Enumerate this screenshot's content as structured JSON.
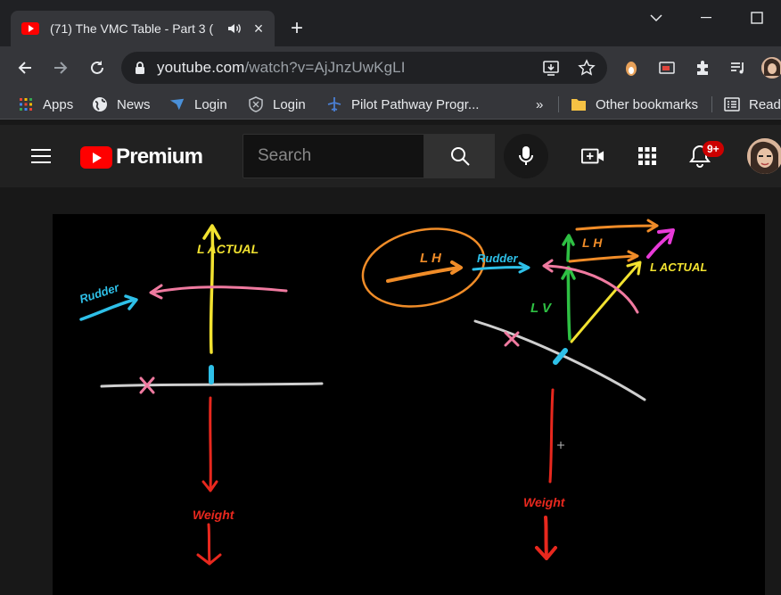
{
  "browser": {
    "tab": {
      "title": "(71) The VMC Table - Part 3 (",
      "close_glyph": "×"
    },
    "new_tab_glyph": "+",
    "window_controls": {
      "minimize": "—",
      "restore": "❐",
      "close": "✕"
    },
    "address": {
      "host": "youtube.com",
      "path": "/watch?v=AjJnzUwKgLI"
    },
    "bookmarks": [
      {
        "label": "Apps",
        "icon": "apps-grid-icon"
      },
      {
        "label": "News",
        "icon": "globe-icon"
      },
      {
        "label": "Login",
        "icon": "blue-check-icon"
      },
      {
        "label": "Login",
        "icon": "shield-icon"
      },
      {
        "label": "Pilot Pathway Progr...",
        "icon": "plane-icon"
      }
    ],
    "bookmarks_overflow": "»",
    "other_bookmarks": "Other bookmarks",
    "reading_list": "Readi"
  },
  "youtube": {
    "logo_text": "Premium",
    "search_placeholder": "Search",
    "notification_count": "9+",
    "brand_color": "#ff0000"
  },
  "video": {
    "whiteboard_labels": {
      "lift_left": "L ACTUAL",
      "rudder_left": "Rudder",
      "weight_left": "Weight",
      "lh": "L H",
      "rudder_right": "Rudder",
      "lh_top": "L H",
      "lv": "L V",
      "lift_right": "L ACTUAL",
      "weight_right": "Weight"
    }
  }
}
